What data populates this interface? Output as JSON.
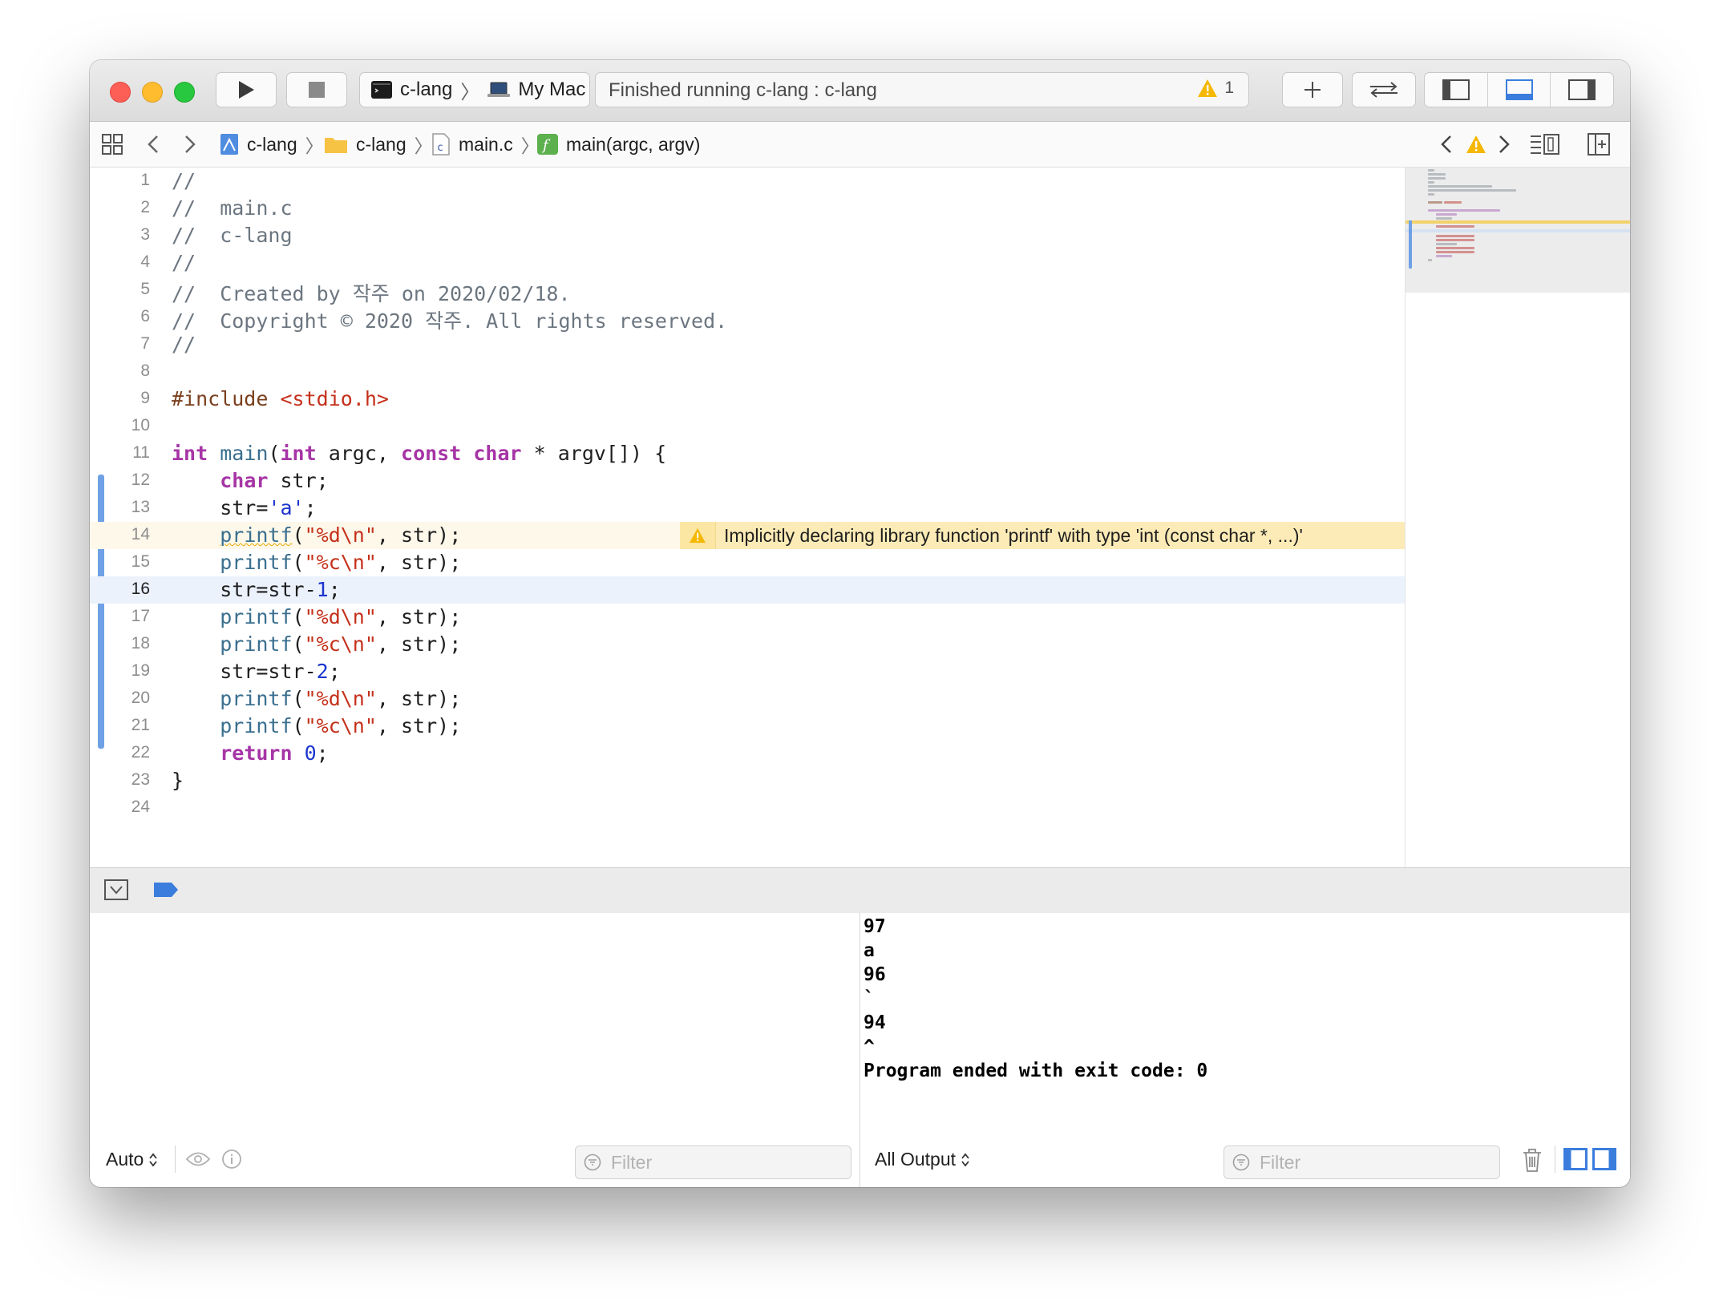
{
  "toolbar": {
    "scheme_target": "c-lang",
    "scheme_destination": "My Mac",
    "activity_status": "Finished running c-lang : c-lang",
    "warning_count": "1"
  },
  "jumpbar": {
    "project": "c-lang",
    "folder": "c-lang",
    "file": "main.c",
    "symbol": "main(argc, argv)"
  },
  "editor": {
    "lines": [
      {
        "n": "1"
      },
      {
        "n": "2"
      },
      {
        "n": "3"
      },
      {
        "n": "4"
      },
      {
        "n": "5"
      },
      {
        "n": "6"
      },
      {
        "n": "7"
      },
      {
        "n": "8"
      },
      {
        "n": "9"
      },
      {
        "n": "10"
      },
      {
        "n": "11"
      },
      {
        "n": "12"
      },
      {
        "n": "13"
      },
      {
        "n": "14"
      },
      {
        "n": "15"
      },
      {
        "n": "16"
      },
      {
        "n": "17"
      },
      {
        "n": "18"
      },
      {
        "n": "19"
      },
      {
        "n": "20"
      },
      {
        "n": "21"
      },
      {
        "n": "22"
      },
      {
        "n": "23"
      },
      {
        "n": "24"
      }
    ],
    "tokens": {
      "l1": "//",
      "l2": "//  main.c",
      "l3": "//  c-lang",
      "l4": "//",
      "l5": "//  Created by 작주 on 2020/02/18.",
      "l6": "//  Copyright © 2020 작주. All rights reserved.",
      "l7": "//",
      "include_kw": "#include",
      "include_hdr": "<stdio.h>",
      "int": "int",
      "main": "main",
      "const": "const",
      "char": "char",
      "return": "return",
      "printf": "printf",
      "fmt_d": "\"%d\\n\"",
      "fmt_c": "\"%c\\n\"",
      "char_a": "'a'",
      "num0": "0",
      "num1": "1",
      "num2": "2"
    },
    "warning_message": "Implicitly declaring library function 'printf' with type 'int (const char *, ...)'",
    "current_line": "16",
    "warning_line": "14"
  },
  "debug": {
    "console_output": "97\na\n96\n`\n94\n^\nProgram ended with exit code: 0",
    "variables_scope": "Auto",
    "output_scope": "All Output",
    "filter_placeholder": "Filter"
  },
  "colors": {
    "accent": "#3b7ddd",
    "warning": "#f5b800",
    "keyword": "#a635a6",
    "string": "#c4301a",
    "number": "#1c35cf",
    "comment": "#6c7680"
  }
}
